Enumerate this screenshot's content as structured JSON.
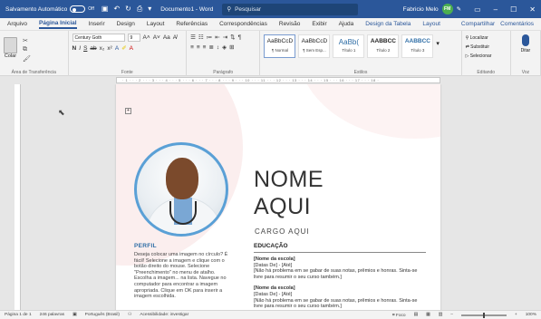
{
  "titlebar": {
    "autosave_label": "Salvamento Automático",
    "toggle_state": "Off",
    "doc_title": "Documento1 - Word",
    "search_placeholder": "Pesquisar",
    "user_name": "Fabricio Melo",
    "user_initials": "FM",
    "colors": {
      "bar": "#2b579a"
    }
  },
  "tabs": [
    "Arquivo",
    "Página Inicial",
    "Inserir",
    "Design",
    "Layout",
    "Referências",
    "Correspondências",
    "Revisão",
    "Exibir",
    "Ajuda",
    "Design da Tabela",
    "Layout"
  ],
  "tabs_right": {
    "share": "Compartilhar",
    "comments": "Comentários"
  },
  "ribbon": {
    "clipboard": {
      "paste": "Colar",
      "label": "Área de Transferência"
    },
    "font": {
      "family": "Century Goth",
      "size": "9",
      "label": "Fonte"
    },
    "paragraph": {
      "label": "Parágrafo"
    },
    "styles": {
      "label": "Estilos",
      "items": [
        {
          "preview": "AaBbCcD",
          "name": "¶ Normal"
        },
        {
          "preview": "AaBbCcD",
          "name": "¶ Sem Esp..."
        },
        {
          "preview": "AaBb(",
          "name": "Título 1"
        },
        {
          "preview": "AABBCC",
          "name": "Título 2"
        },
        {
          "preview": "AABBCC",
          "name": "Título 3"
        }
      ]
    },
    "editing": {
      "find": "Localizar",
      "replace": "Substituir",
      "select": "Selecionar",
      "label": "Editando"
    },
    "voice": {
      "dictate": "Ditar",
      "label": "Voz"
    }
  },
  "document": {
    "name_line1": "NOME",
    "name_line2": "AQUI",
    "job_title": "CARGO AQUI",
    "profile_heading": "PERFIL",
    "profile_text": "Deseja colocar uma imagem no círculo? É fácil! Selecione a imagem e clique com o botão direito do mouse. Selecione \"Preenchimento\" no menu de atalho. Escolha a imagem... na lista. Navegue no computador para encontrar a imagem apropriada. Clique em OK para inserir a imagem escolhida.",
    "education_heading": "EDUCAÇÃO",
    "education": [
      {
        "school": "[Nome da escola]",
        "dates": "[Datas De] - [Até]",
        "desc": "[Não há problema em se gabar de suas notas, prêmios e honras. Sinta-se livre para resumir o seu curso também.]"
      },
      {
        "school": "[Nome da escola]",
        "dates": "[Datas De] - [Até]",
        "desc": "[Não há problema em se gabar de suas notas, prêmios e honras. Sinta-se livre para resumir o seu curso também.]"
      }
    ],
    "colors": {
      "accent": "#5aa0d6",
      "heading": "#2f6ea6"
    }
  },
  "status": {
    "page": "Página 1 de 1",
    "words": "246 palavras",
    "language": "Português (Brasil)",
    "accessibility": "Acessibilidade: investigar",
    "focus": "Foco",
    "zoom": "100%"
  }
}
